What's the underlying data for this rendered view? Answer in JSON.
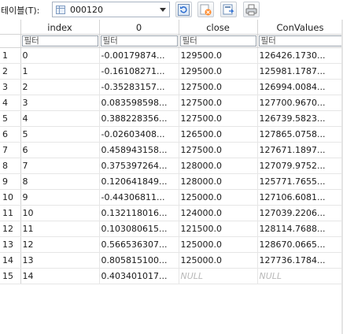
{
  "toolbar": {
    "label": "테이블(T):",
    "table_name": "000120",
    "buttons": [
      "refresh-icon",
      "cancel-filter-icon",
      "export-icon",
      "print-icon"
    ]
  },
  "grid": {
    "filter_placeholder": "필터",
    "columns": [
      "index",
      "0",
      "close",
      "ConValues"
    ],
    "rows": [
      {
        "n": "1",
        "index": "0",
        "v0": "-0.00179874...",
        "close": "129500.0",
        "con": "126426.1730..."
      },
      {
        "n": "2",
        "index": "1",
        "v0": "-0.16108271...",
        "close": "129500.0",
        "con": "125981.1787..."
      },
      {
        "n": "3",
        "index": "2",
        "v0": "-0.35283157...",
        "close": "127500.0",
        "con": "126994.0084..."
      },
      {
        "n": "4",
        "index": "3",
        "v0": "0.083598598...",
        "close": "127500.0",
        "con": "127700.9670..."
      },
      {
        "n": "5",
        "index": "4",
        "v0": "0.388228356...",
        "close": "127500.0",
        "con": "126739.5823..."
      },
      {
        "n": "6",
        "index": "5",
        "v0": "-0.02603408...",
        "close": "126500.0",
        "con": "127865.0758..."
      },
      {
        "n": "7",
        "index": "6",
        "v0": "0.458943158...",
        "close": "127500.0",
        "con": "127671.1897..."
      },
      {
        "n": "8",
        "index": "7",
        "v0": "0.375397264...",
        "close": "128000.0",
        "con": "127079.9752..."
      },
      {
        "n": "9",
        "index": "8",
        "v0": "0.120641849...",
        "close": "128000.0",
        "con": "125771.7655..."
      },
      {
        "n": "10",
        "index": "9",
        "v0": "-0.44306811...",
        "close": "125000.0",
        "con": "127106.6081..."
      },
      {
        "n": "11",
        "index": "10",
        "v0": "0.132118016...",
        "close": "124000.0",
        "con": "127039.2206..."
      },
      {
        "n": "12",
        "index": "11",
        "v0": "0.103080615...",
        "close": "121500.0",
        "con": "128114.7688..."
      },
      {
        "n": "13",
        "index": "12",
        "v0": "0.566536307...",
        "close": "125000.0",
        "con": "128670.0665..."
      },
      {
        "n": "14",
        "index": "13",
        "v0": "0.805815100...",
        "close": "125000.0",
        "con": "127736.1784..."
      },
      {
        "n": "15",
        "index": "14",
        "v0": "0.403401017...",
        "close": "NULL",
        "con": "NULL"
      }
    ]
  }
}
